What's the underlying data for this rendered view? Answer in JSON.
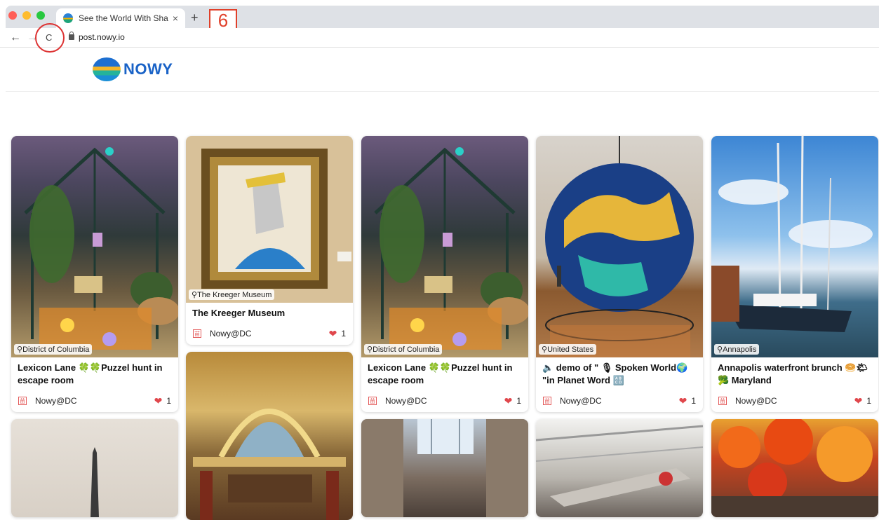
{
  "browser": {
    "tab_title": "See the World With Share",
    "tab_close": "×",
    "new_tab": "+",
    "url": "post.nowy.io",
    "back": "←",
    "forward": "→",
    "reload": "C",
    "step_annotation": "6",
    "colors": {
      "tabstrip": "#dee1e6",
      "annotation": "#e0402a"
    }
  },
  "site": {
    "logo_text": "NOWY",
    "brand_color": "#1a63c7"
  },
  "cards": [
    {
      "location": "District of Columbia",
      "title": "Lexicon Lane 🍀🍀Puzzel hunt in escape room",
      "author": "Nowy@DC",
      "likes": "1",
      "heart": "❤",
      "avatar_icon": "calendar-icon"
    },
    {
      "location": "The Kreeger Museum",
      "title": "The Kreeger Museum",
      "author": "Nowy@DC",
      "likes": "1",
      "heart": "❤",
      "avatar_icon": "calendar-icon"
    },
    {
      "location": "District of Columbia",
      "title": "Lexicon Lane 🍀🍀Puzzel hunt in escape room",
      "author": "Nowy@DC",
      "likes": "1",
      "heart": "❤",
      "avatar_icon": "calendar-icon"
    },
    {
      "location": "United States",
      "title": "🔈 demo of \" 🎙 Spoken World🌍 \"in Planet Word 🔠",
      "author": "Nowy@DC",
      "likes": "1",
      "heart": "❤",
      "avatar_icon": "calendar-icon"
    },
    {
      "location": "Annapolis",
      "title": "Annapolis waterfront brunch 🥯🌤🥦 Maryland",
      "author": "Nowy@DC",
      "likes": "1",
      "heart": "❤",
      "avatar_icon": "calendar-icon"
    }
  ]
}
